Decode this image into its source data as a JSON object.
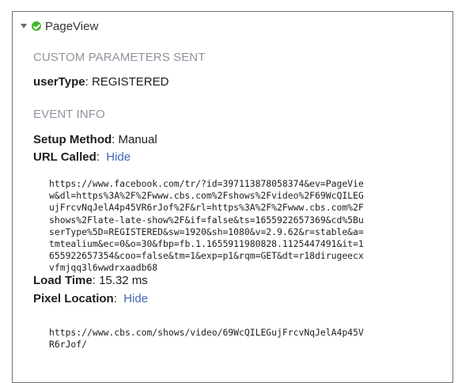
{
  "event": {
    "name": "PageView"
  },
  "sections": {
    "custom_params_title": "CUSTOM PARAMETERS SENT",
    "event_info_title": "EVENT INFO"
  },
  "params": {
    "usertype_key": "userType",
    "usertype_sep": ": ",
    "usertype_value": "REGISTERED"
  },
  "info": {
    "setup_key": "Setup Method",
    "setup_sep": ": ",
    "setup_value": "Manual",
    "url_key": "URL Called",
    "url_sep": ":  ",
    "url_toggle": "Hide",
    "url_lines": [
      "https://www.facebook.com/tr/?id=397113878058374&ev=PageVie",
      "w&dl=https%3A%2F%2Fwww.cbs.com%2Fshows%2Fvideo%2F69WcQILEG",
      "ujFrcvNqJelA4p45VR6rJof%2F&rl=https%3A%2F%2Fwww.cbs.com%2F",
      "shows%2Flate-late-show%2F&if=false&ts=1655922657369&cd%5Bu",
      "serType%5D=REGISTERED&sw=1920&sh=1080&v=2.9.62&r=stable&a=",
      "tmtealium&ec=0&o=30&fbp=fb.1.1655911980828.1125447491&it=1",
      "655922657354&coo=false&tm=1&exp=p1&rqm=GET&dt=r18dirugeecx",
      "vfmjqq3l6wwdrxaadb68"
    ],
    "load_key": "Load Time",
    "load_sep": ": ",
    "load_value": "15.32 ms",
    "pixel_key": "Pixel Location",
    "pixel_sep": ":  ",
    "pixel_toggle": "Hide",
    "pixel_lines": [
      "https://www.cbs.com/shows/video/69WcQILEGujFrcvNqJelA4p45V",
      "R6rJof/"
    ]
  },
  "colors": {
    "status": "#42b72a",
    "link": "#4267b2",
    "section_title": "#8d949e"
  }
}
